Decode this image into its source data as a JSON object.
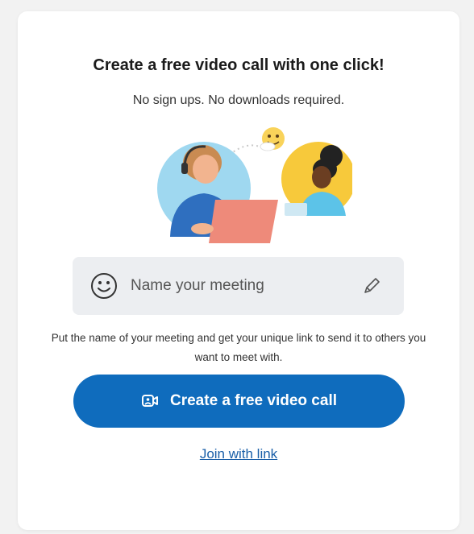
{
  "card": {
    "title": "Create a free video call with one click!",
    "subtitle": "No sign ups. No downloads required."
  },
  "meeting_input": {
    "placeholder": "Name your meeting",
    "value": "",
    "left_icon": "smile-icon",
    "right_icon": "pencil-icon"
  },
  "helper_text": "Put the name of your meeting and get your unique link to send it to others you want to meet with.",
  "primary_button": {
    "label": "Create a free video call",
    "icon": "video-call-icon",
    "color": "#0f6cbd"
  },
  "join_link": {
    "label": "Join with link"
  },
  "illustration": {
    "icon": "video-call-illustration",
    "accent_colors": [
      "#9fd8f0",
      "#f7c93b",
      "#2f6fbf",
      "#ee8a7a"
    ]
  }
}
